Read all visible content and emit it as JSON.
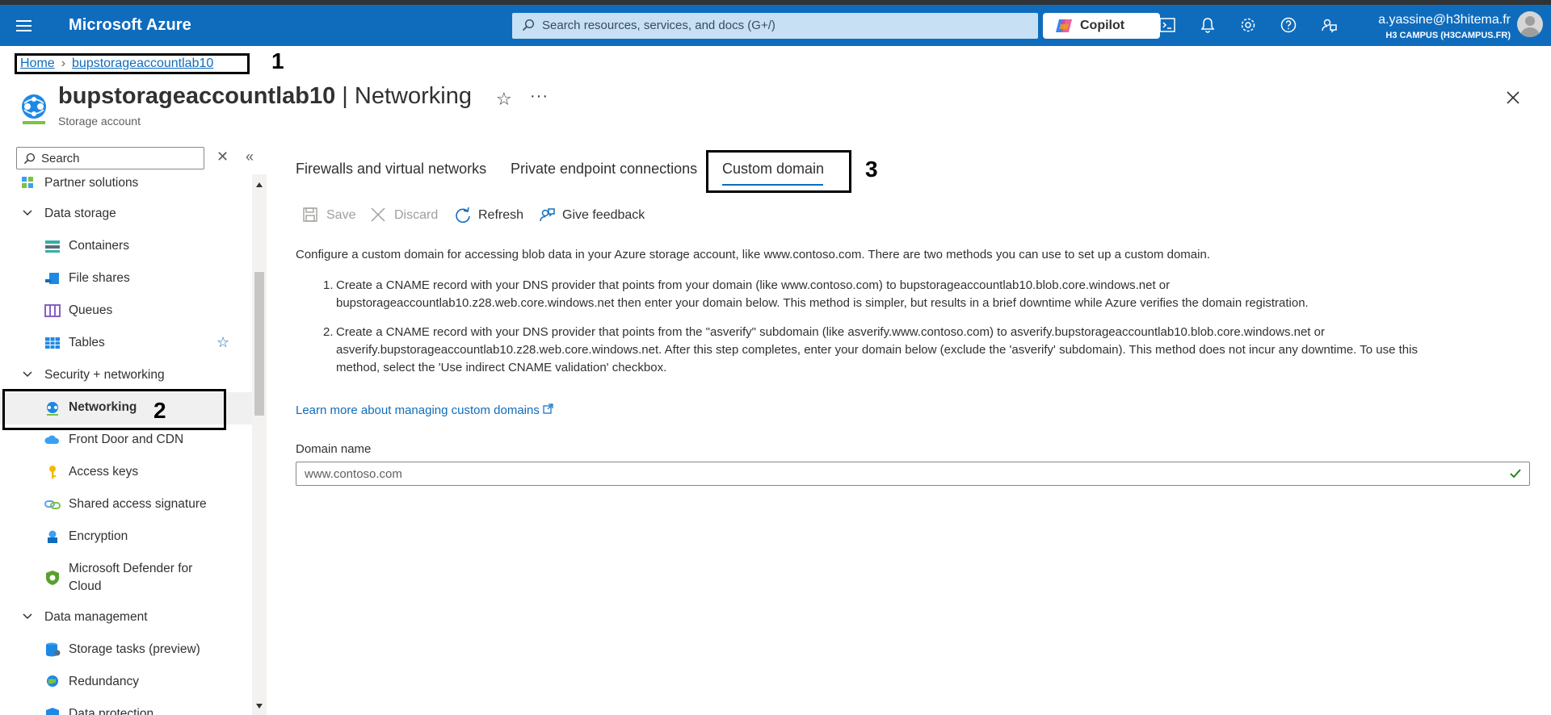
{
  "topbar": {
    "brand": "Microsoft Azure",
    "search_placeholder": "Search resources, services, and docs (G+/)",
    "copilot_label": "Copilot",
    "account_email": "a.yassine@h3hitema.fr",
    "account_tenant": "H3 CAMPUS (H3CAMPUS.FR)",
    "icons": [
      "menu-icon",
      "cloud-shell-icon",
      "bell-icon",
      "gear-icon",
      "help-icon",
      "feedback-icon"
    ]
  },
  "breadcrumb": {
    "home": "Home",
    "resource": "bupstorageaccountlab10",
    "annotation": "1"
  },
  "header": {
    "resource_name": "bupstorageaccountlab10",
    "separator": " | ",
    "blade": "Networking",
    "subtitle": "Storage account"
  },
  "sidebar": {
    "search_placeholder": "Search",
    "items": [
      {
        "label": "Partner solutions",
        "kind": "item"
      },
      {
        "label": "Data storage",
        "kind": "group"
      },
      {
        "label": "Containers",
        "kind": "item"
      },
      {
        "label": "File shares",
        "kind": "item"
      },
      {
        "label": "Queues",
        "kind": "item"
      },
      {
        "label": "Tables",
        "kind": "item"
      },
      {
        "label": "Security + networking",
        "kind": "group"
      },
      {
        "label": "Networking",
        "kind": "item",
        "selected": true
      },
      {
        "label": "Front Door and CDN",
        "kind": "item"
      },
      {
        "label": "Access keys",
        "kind": "item"
      },
      {
        "label": "Shared access signature",
        "kind": "item"
      },
      {
        "label": "Encryption",
        "kind": "item"
      },
      {
        "label": "Microsoft Defender for",
        "label2": "Cloud",
        "kind": "item"
      },
      {
        "label": "Data management",
        "kind": "group"
      },
      {
        "label": "Storage tasks (preview)",
        "kind": "item"
      },
      {
        "label": "Redundancy",
        "kind": "item"
      },
      {
        "label": "Data protection",
        "kind": "item"
      }
    ],
    "annotation": "2"
  },
  "tabs": {
    "items": [
      "Firewalls and virtual networks",
      "Private endpoint connections",
      "Custom domain"
    ],
    "active": "Custom domain",
    "annotation": "3"
  },
  "toolbar": {
    "save": "Save",
    "discard": "Discard",
    "refresh": "Refresh",
    "feedback": "Give feedback"
  },
  "content": {
    "intro": "Configure a custom domain for accessing blob data in your Azure storage account, like www.contoso.com. There are two methods you can use to set up a custom domain.",
    "steps": [
      {
        "num": "1.",
        "line1": "Create a CNAME record with your DNS provider that points from your domain (like www.contoso.com) to bupstorageaccountlab10.blob.core.windows.net or",
        "line2": "bupstorageaccountlab10.z28.web.core.windows.net then enter your domain below. This method is simpler, but results in a brief downtime while Azure verifies the domain registration."
      },
      {
        "num": "2.",
        "line1": "Create a CNAME record with your DNS provider that points from the \"asverify\" subdomain (like asverify.www.contoso.com) to asverify.bupstorageaccountlab10.blob.core.windows.net or",
        "line2": "asverify.bupstorageaccountlab10.z28.web.core.windows.net. After this step completes, enter your domain below (exclude the 'asverify' subdomain). This method does not incur any downtime. To use this",
        "line3": "method, select the 'Use indirect CNAME validation' checkbox."
      }
    ],
    "learn_more": "Learn more about managing custom domains",
    "domain_label": "Domain name",
    "domain_value": "www.contoso.com"
  },
  "colors": {
    "azure_blue": "#0f6cbd",
    "search_bg": "#c7e0f4",
    "success_check": "#107c10"
  }
}
